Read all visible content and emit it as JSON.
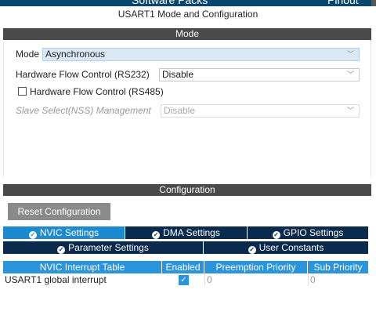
{
  "topbar": {
    "left_label": "Software Packs",
    "right_label": "Pinout"
  },
  "panel_title": "USART1 Mode and Configuration",
  "mode_section": {
    "header": "Mode",
    "mode_label": "Mode",
    "mode_value": "Asynchronous",
    "hw_flow_rs232_label": "Hardware Flow Control (RS232)",
    "hw_flow_rs232_value": "Disable",
    "hw_flow_rs485_label": "Hardware Flow Control (RS485)",
    "nss_label": "Slave Select(NSS) Management",
    "nss_value": "Disable"
  },
  "config_section": {
    "header": "Configuration",
    "reset_button": "Reset Configuration",
    "tabs_row1": [
      "NVIC Settings",
      "DMA Settings",
      "GPIO Settings"
    ],
    "tabs_row2": [
      "Parameter Settings",
      "User Constants"
    ],
    "active_tab": "NVIC Settings"
  },
  "nvic_table": {
    "headers": [
      "NVIC Interrupt Table",
      "Enabled",
      "Preemption Priority",
      "Sub Priority"
    ],
    "rows": [
      {
        "name": "USART1 global interrupt",
        "enabled": true,
        "preemption": "0",
        "sub": "0"
      }
    ]
  },
  "icons": {
    "dropdown": "chevron-down-icon",
    "tab_check": "check-circle-icon",
    "enabled_check": "checkmark-icon"
  },
  "colors": {
    "active_tab": "#1c8ad1",
    "tab": "#0a2a4e",
    "table_header": "#2a94dc",
    "section_bar": "#4a4a4a",
    "highlight_select": "#d9e8f5"
  }
}
